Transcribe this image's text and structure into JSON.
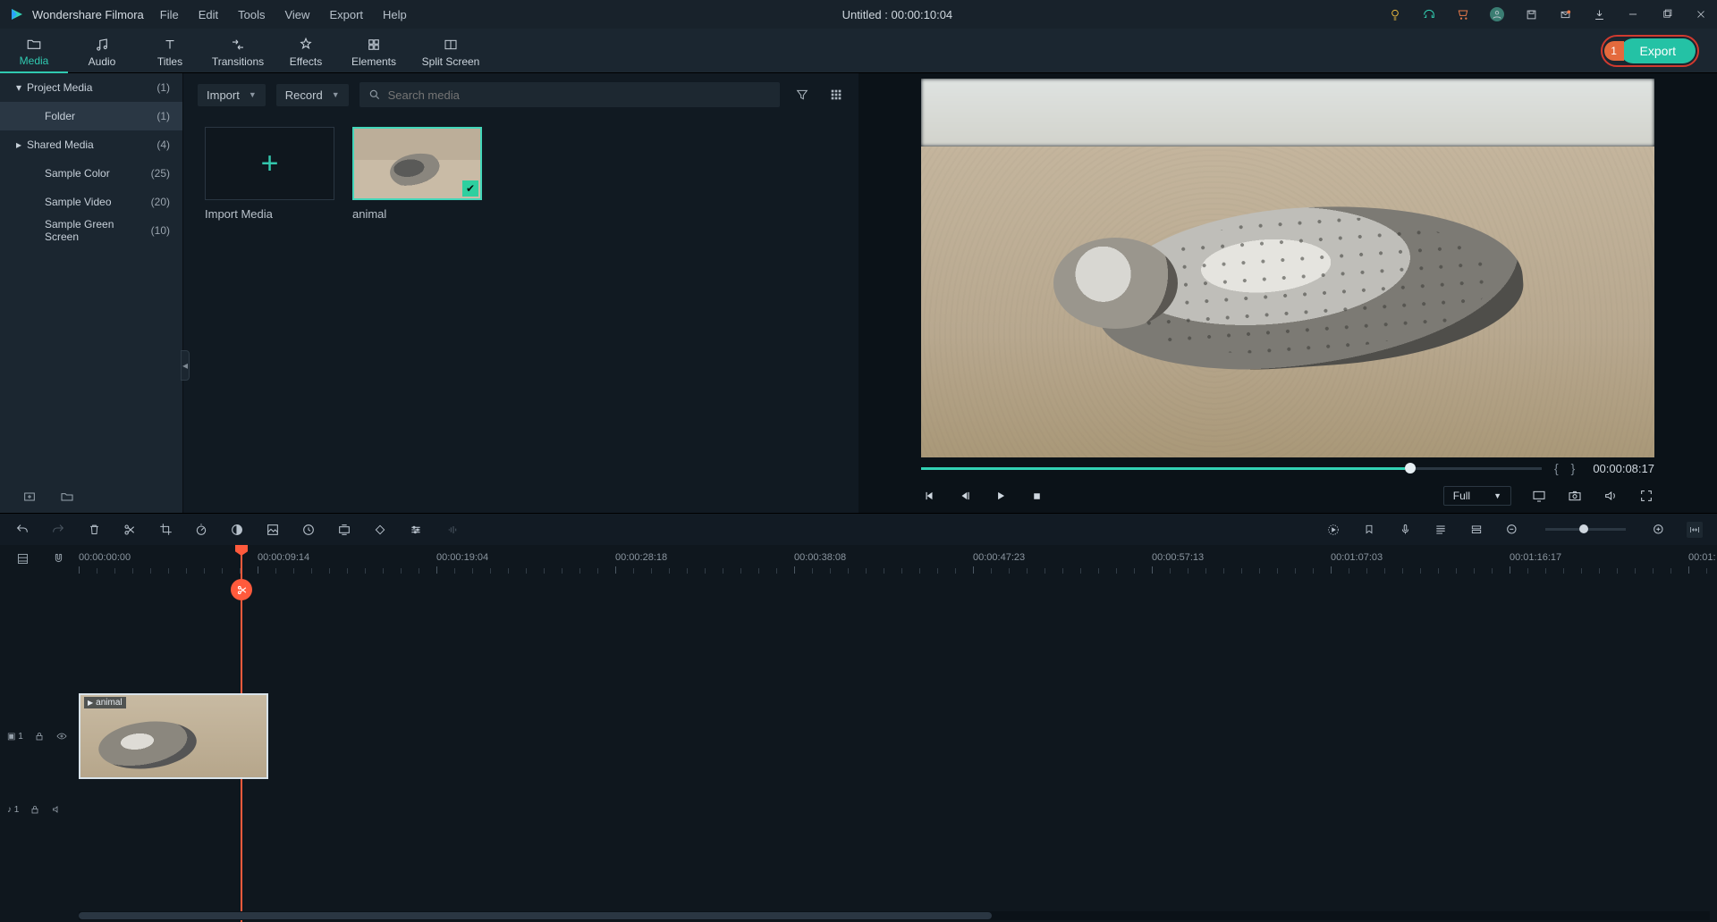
{
  "app_name": "Wondershare Filmora",
  "menus": [
    "File",
    "Edit",
    "Tools",
    "View",
    "Export",
    "Help"
  ],
  "doc_title": "Untitled : 00:00:10:04",
  "ribbon_tabs": [
    {
      "label": "Media",
      "active": true
    },
    {
      "label": "Audio",
      "active": false
    },
    {
      "label": "Titles",
      "active": false
    },
    {
      "label": "Transitions",
      "active": false
    },
    {
      "label": "Effects",
      "active": false
    },
    {
      "label": "Elements",
      "active": false
    },
    {
      "label": "Split Screen",
      "active": false
    }
  ],
  "export_badge": "1",
  "export_label": "Export",
  "sidebar": [
    {
      "label": "Project Media",
      "count": "(1)",
      "arrow": "down",
      "sel": false,
      "indent": 0
    },
    {
      "label": "Folder",
      "count": "(1)",
      "arrow": "",
      "sel": true,
      "indent": 1
    },
    {
      "label": "Shared Media",
      "count": "(4)",
      "arrow": "right",
      "sel": false,
      "indent": 0
    },
    {
      "label": "Sample Color",
      "count": "(25)",
      "arrow": "",
      "sel": false,
      "indent": 1
    },
    {
      "label": "Sample Video",
      "count": "(20)",
      "arrow": "",
      "sel": false,
      "indent": 1
    },
    {
      "label": "Sample Green Screen",
      "count": "(10)",
      "arrow": "",
      "sel": false,
      "indent": 1
    }
  ],
  "media_toolbar": {
    "import": "Import",
    "record": "Record",
    "search_placeholder": "Search media"
  },
  "media_tiles": {
    "import_media": "Import Media",
    "clip1": "animal"
  },
  "preview": {
    "time": "00:00:08:17",
    "full": "Full"
  },
  "ruler_labels": [
    "00:00:00:00",
    "00:00:09:14",
    "00:00:19:04",
    "00:00:28:18",
    "00:00:38:08",
    "00:00:47:23",
    "00:00:57:13",
    "00:01:07:03",
    "00:01:16:17",
    "00:01:"
  ],
  "clip_label": "animal",
  "track_video_head": "▣ 1",
  "track_audio_head": "♪ 1"
}
